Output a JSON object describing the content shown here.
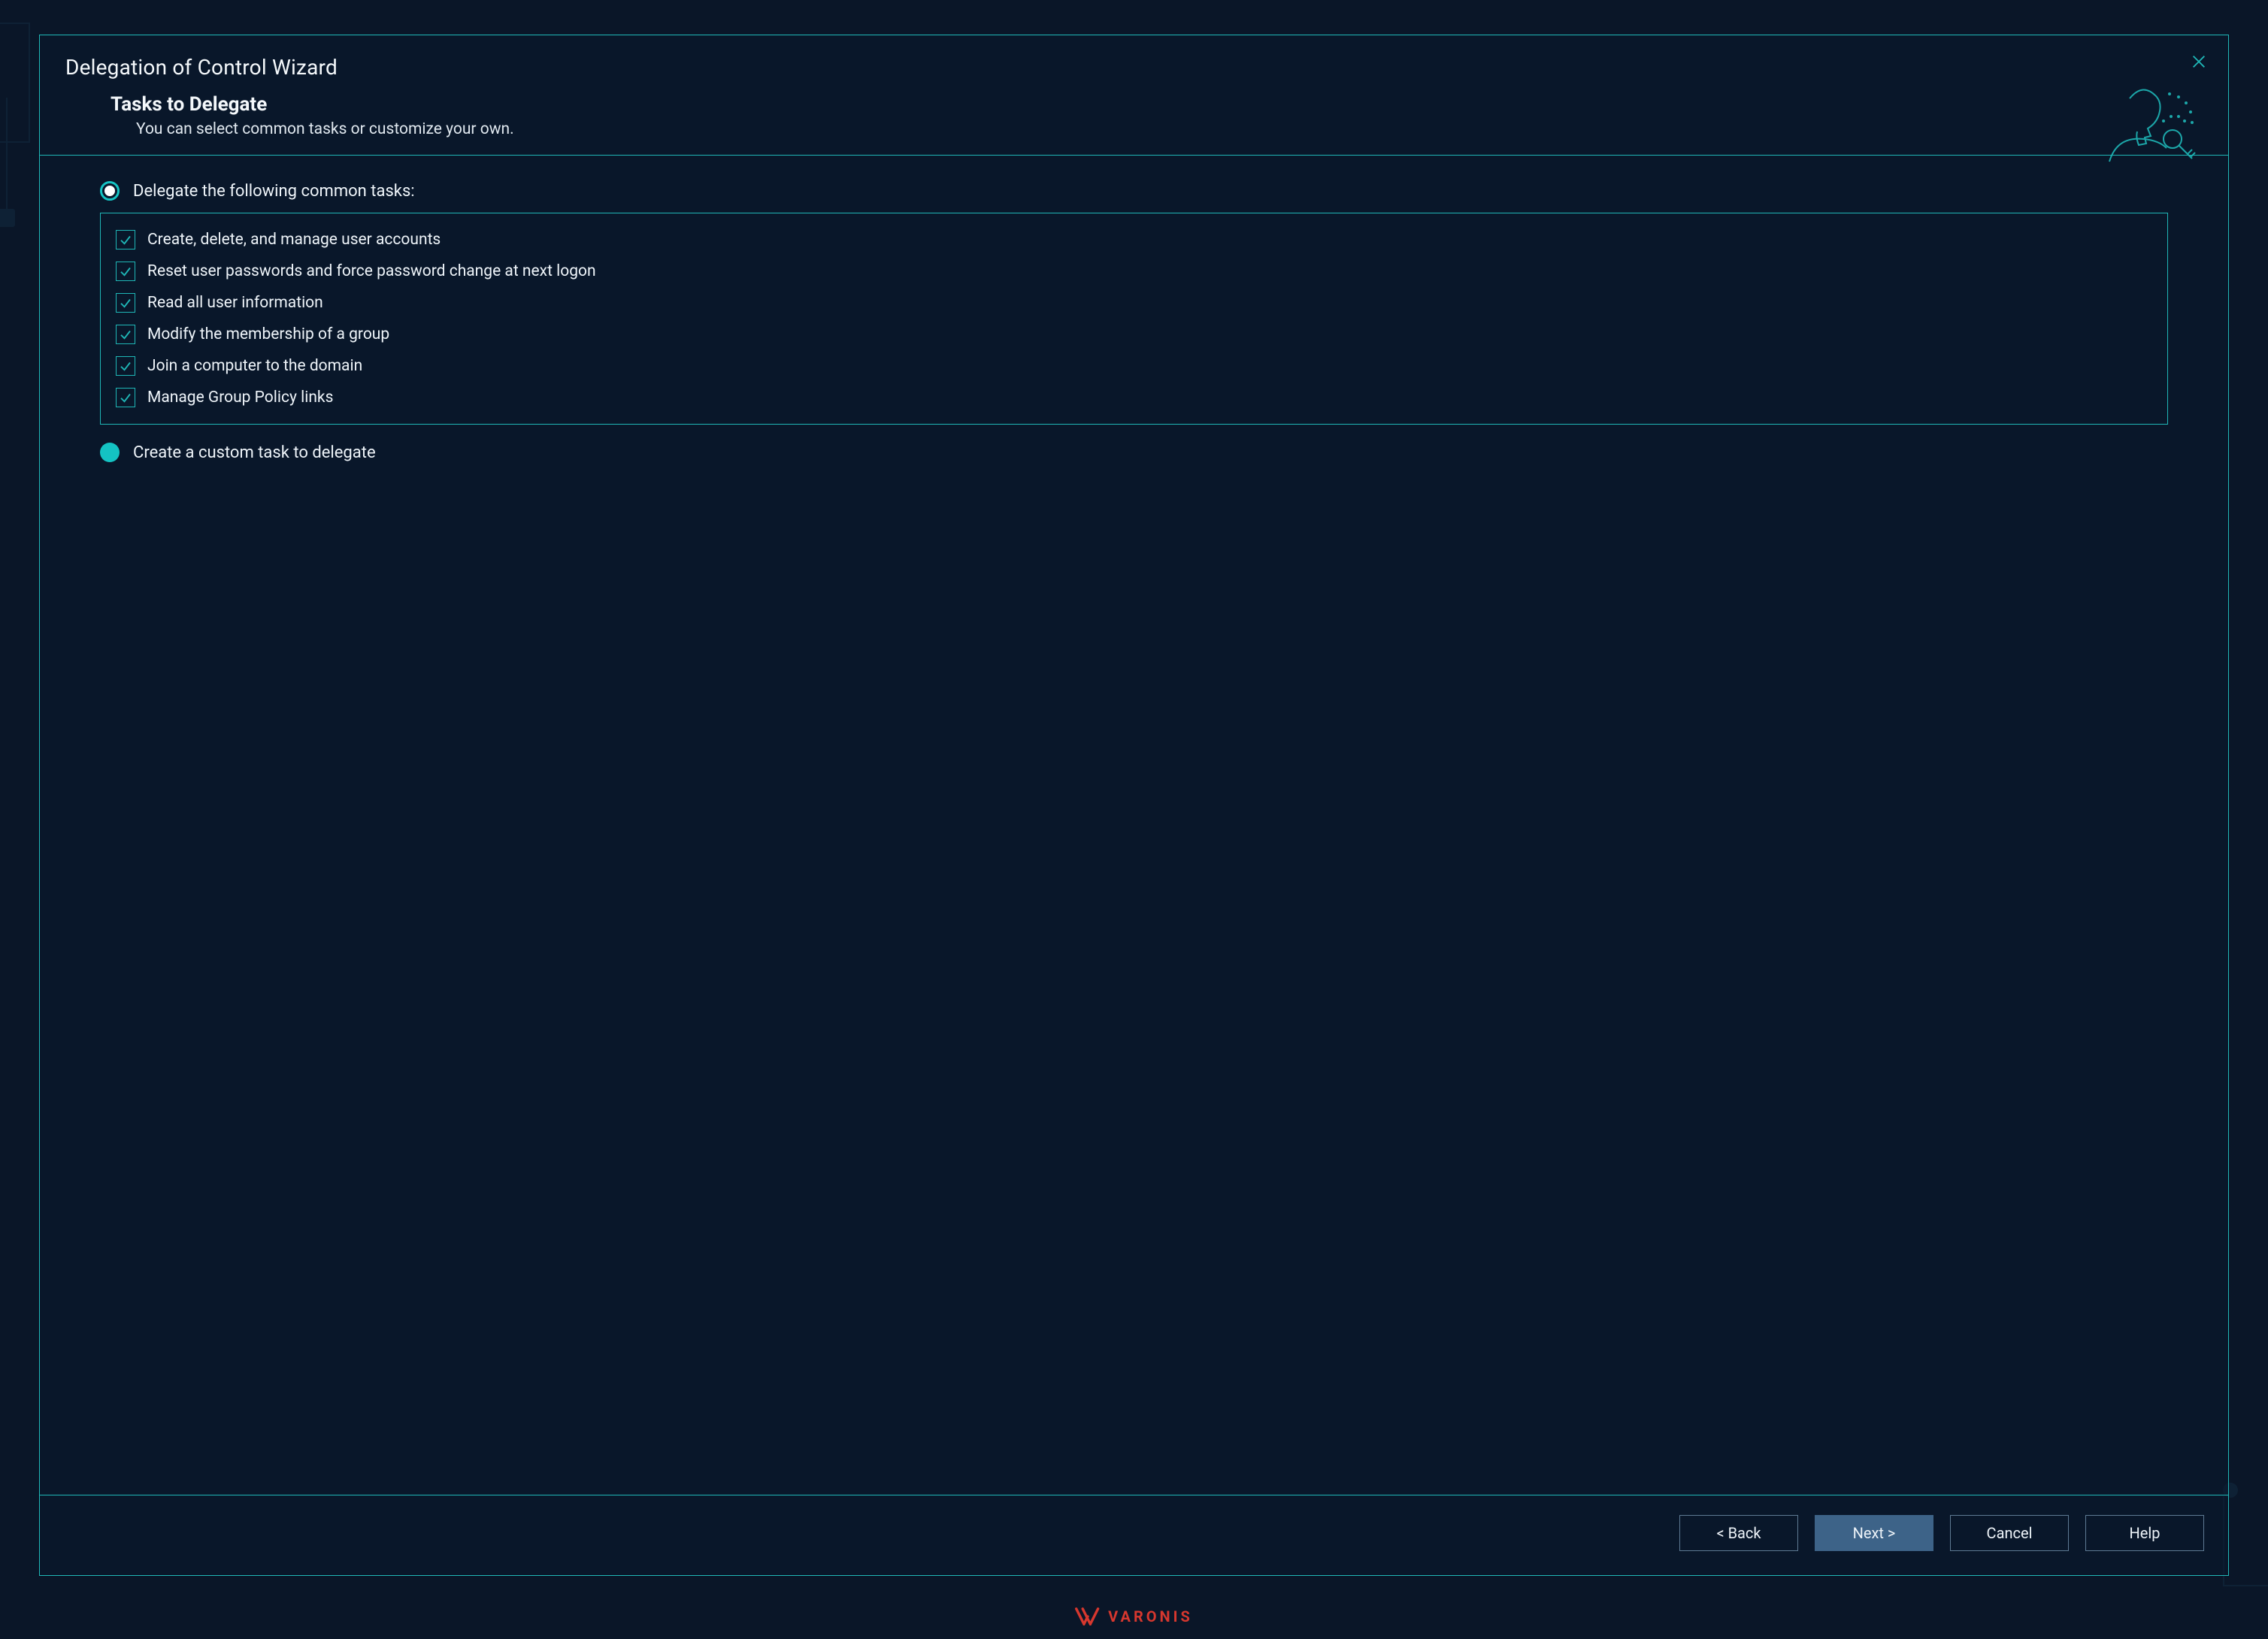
{
  "wizard": {
    "title": "Delegation of Control Wizard",
    "step_title": "Tasks to Delegate",
    "step_sub": "You can select common tasks or customize your own."
  },
  "options": {
    "common_label": "Delegate the following common tasks:",
    "custom_label": "Create a custom task to delegate",
    "selected": "common"
  },
  "tasks": [
    {
      "label": "Create, delete, and manage user accounts",
      "checked": true
    },
    {
      "label": "Reset user passwords and force password change at next logon",
      "checked": true
    },
    {
      "label": "Read all user information",
      "checked": true
    },
    {
      "label": "Modify the membership of a group",
      "checked": true
    },
    {
      "label": "Join a computer to the domain",
      "checked": true
    },
    {
      "label": "Manage Group Policy links",
      "checked": true
    }
  ],
  "buttons": {
    "back": "< Back",
    "next": "Next >",
    "cancel": "Cancel",
    "help": "Help"
  },
  "brand": "VARONIS",
  "colors": {
    "accent": "#1fb7b7",
    "brand": "#d6372e",
    "primary_btn": "#3d6388",
    "bg": "#0a1628"
  }
}
